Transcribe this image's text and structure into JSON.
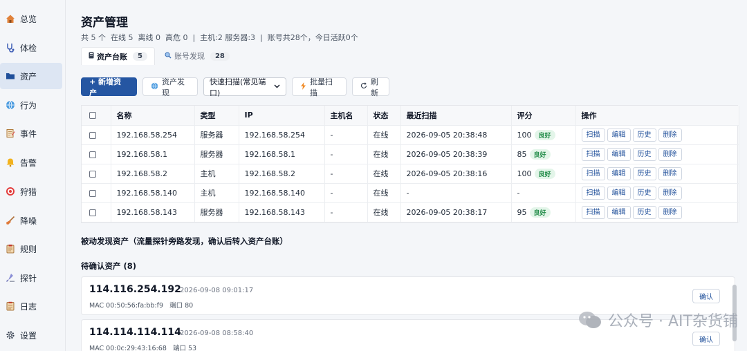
{
  "sidebar": {
    "items": [
      {
        "label": "总览",
        "icon": "home-icon"
      },
      {
        "label": "体检",
        "icon": "stethoscope-icon"
      },
      {
        "label": "资产",
        "icon": "folder-icon",
        "active": true
      },
      {
        "label": "行为",
        "icon": "globe-icon"
      },
      {
        "label": "事件",
        "icon": "note-icon"
      },
      {
        "label": "告警",
        "icon": "bell-icon"
      },
      {
        "label": "狩猎",
        "icon": "target-icon"
      },
      {
        "label": "降噪",
        "icon": "broom-icon"
      },
      {
        "label": "规则",
        "icon": "clipboard-icon"
      },
      {
        "label": "探针",
        "icon": "probe-icon"
      },
      {
        "label": "日志",
        "icon": "log-icon"
      },
      {
        "label": "设置",
        "icon": "gear-icon"
      }
    ]
  },
  "header": {
    "title": "资产管理",
    "summary": "共 5 个  在线 5  离线 0  高危 0  |  主机:2 服务器:3  |  账号共28个，今日活跃0个"
  },
  "tabs": [
    {
      "label": "资产台账",
      "count": "5",
      "icon": "server-icon"
    },
    {
      "label": "账号发现",
      "count": "28",
      "icon": "search-icon"
    }
  ],
  "toolbar": {
    "add_label": "+ 新增资产",
    "discover_label": "资产发现",
    "scan_mode": "快速扫描(常见端口)",
    "batch_scan_label": "批量扫描",
    "refresh_label": "刷新"
  },
  "table": {
    "headers": [
      "名称",
      "类型",
      "IP",
      "主机名",
      "状态",
      "最近扫描",
      "评分",
      "操作"
    ],
    "actions": [
      "扫描",
      "编辑",
      "历史",
      "删除"
    ],
    "rows": [
      {
        "name": "192.168.58.254",
        "type": "服务器",
        "ip": "192.168.58.254",
        "host": "-",
        "status": "在线",
        "scan": "2026-09-05 20:38:48",
        "score": "100",
        "badge": "良好"
      },
      {
        "name": "192.168.58.1",
        "type": "服务器",
        "ip": "192.168.58.1",
        "host": "-",
        "status": "在线",
        "scan": "2026-09-05 20:38:39",
        "score": "85",
        "badge": "良好"
      },
      {
        "name": "192.168.58.2",
        "type": "主机",
        "ip": "192.168.58.2",
        "host": "-",
        "status": "在线",
        "scan": "2026-09-05 20:38:16",
        "score": "100",
        "badge": "良好"
      },
      {
        "name": "192.168.58.140",
        "type": "主机",
        "ip": "192.168.58.140",
        "host": "-",
        "status": "在线",
        "scan": "-",
        "score": "-",
        "badge": ""
      },
      {
        "name": "192.168.58.143",
        "type": "服务器",
        "ip": "192.168.58.143",
        "host": "-",
        "status": "在线",
        "scan": "2026-09-05 20:38:17",
        "score": "95",
        "badge": "良好"
      }
    ]
  },
  "passive": {
    "title": "被动发现资产（流量探针旁路发现，确认后转入资产台账）",
    "pending_title": "待确认资产 (8)",
    "confirm_label": "确认",
    "cards": [
      {
        "ip": "114.116.254.192",
        "time": "2026-09-08 09:01:17",
        "mac": "MAC 00:50:56:fa:bb:f9",
        "port": "端口 80"
      },
      {
        "ip": "114.114.114.114",
        "time": "2026-09-08 08:58:40",
        "mac": "MAC 00:0c:29:43:16:68",
        "port": "端口 53"
      }
    ]
  },
  "watermark": {
    "text": "公众号 · AIT杂货铺"
  },
  "colors": {
    "primary": "#2556a2",
    "good_bg": "#e3f5e9",
    "good_text": "#1e8a46"
  }
}
